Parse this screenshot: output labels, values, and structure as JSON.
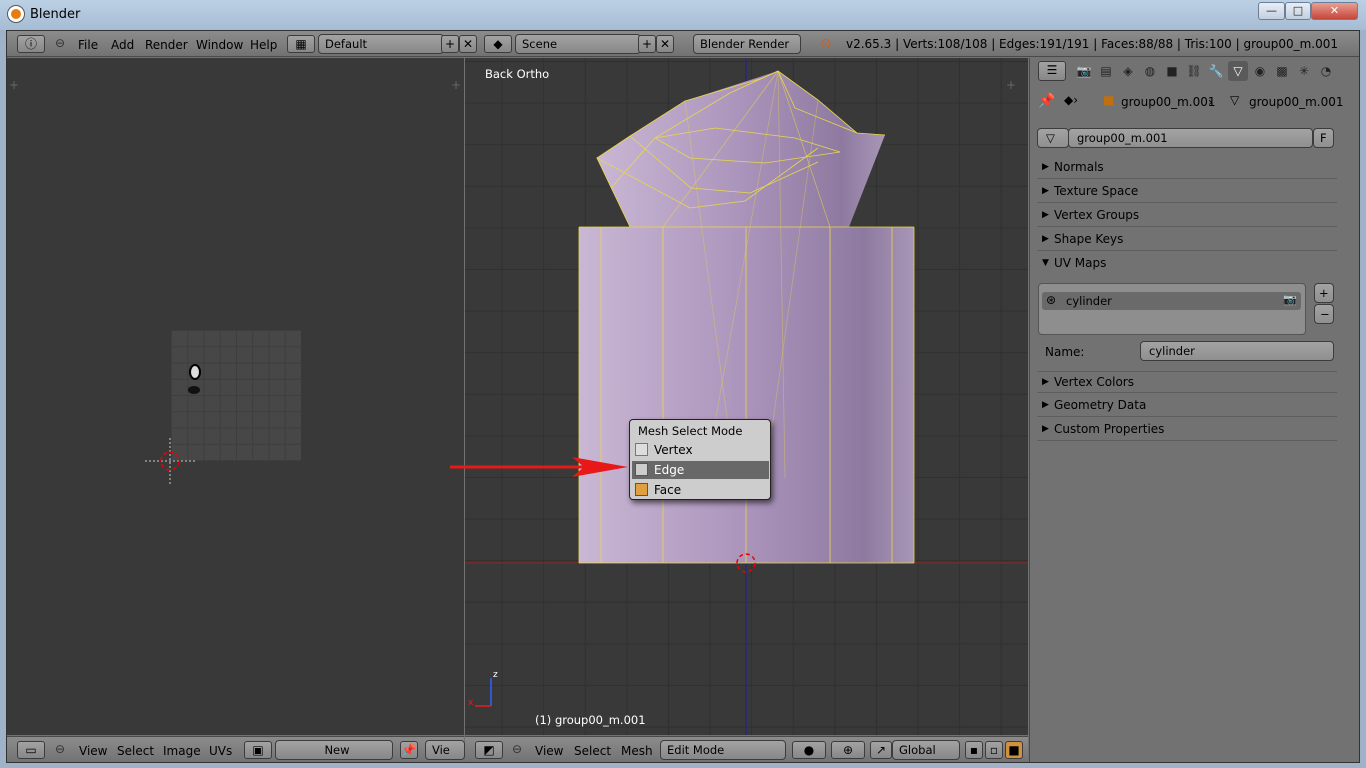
{
  "window": {
    "title": "Blender",
    "minimize": "—",
    "maximize": "□",
    "close": "✕"
  },
  "infobar": {
    "menus": [
      "File",
      "Add",
      "Render",
      "Window",
      "Help"
    ],
    "layout": "Default",
    "scene": "Scene",
    "engine": "Blender Render",
    "stats": "v2.65.3 | Verts:108/108 | Edges:191/191 | Faces:88/88 | Tris:100 | group00_m.001"
  },
  "image_editor": {
    "footer": {
      "menus": [
        "View",
        "Select",
        "Image",
        "UVs"
      ],
      "new_label": "New",
      "cut_label": "Vie"
    }
  },
  "view3d": {
    "view_label": "Back Ortho",
    "object_label": "(1) group00_m.001",
    "axis_z": "z",
    "axis_x": "x",
    "footer": {
      "menus": [
        "View",
        "Select",
        "Mesh"
      ],
      "mode": "Edit Mode",
      "orientation": "Global"
    }
  },
  "popup": {
    "title": "Mesh Select Mode",
    "items": [
      {
        "label": "Vertex"
      },
      {
        "label": "Edge"
      },
      {
        "label": "Face"
      }
    ]
  },
  "properties": {
    "breadcrumb": [
      "group00_m.001",
      "group00_m.001"
    ],
    "datablock": "group00_m.001",
    "fake_user": "F",
    "panels_top": [
      "Normals",
      "Texture Space",
      "Vertex Groups",
      "Shape Keys"
    ],
    "uv_panel": "UV Maps",
    "uv_item": "cylinder",
    "name_label": "Name:",
    "name_value": "cylinder",
    "panels_bottom": [
      "Vertex Colors",
      "Geometry Data",
      "Custom Properties"
    ]
  },
  "colors": {
    "mesh_face": "#b8a2c4",
    "edge": "#e8d84a",
    "annotation_arrow": "#e81818",
    "selected_item": "#686868"
  },
  "icons": [
    "blender-logo-icon",
    "info-icon",
    "screen-layout-icon",
    "scene-icon",
    "camera-icon",
    "render-icon",
    "world-icon",
    "object-icon",
    "constraints-icon",
    "modifier-icon",
    "mesh-data-icon",
    "material-icon",
    "texture-icon",
    "particles-icon",
    "physics-icon",
    "pin-icon",
    "vertex-select-icon",
    "edge-select-icon",
    "face-select-icon"
  ]
}
